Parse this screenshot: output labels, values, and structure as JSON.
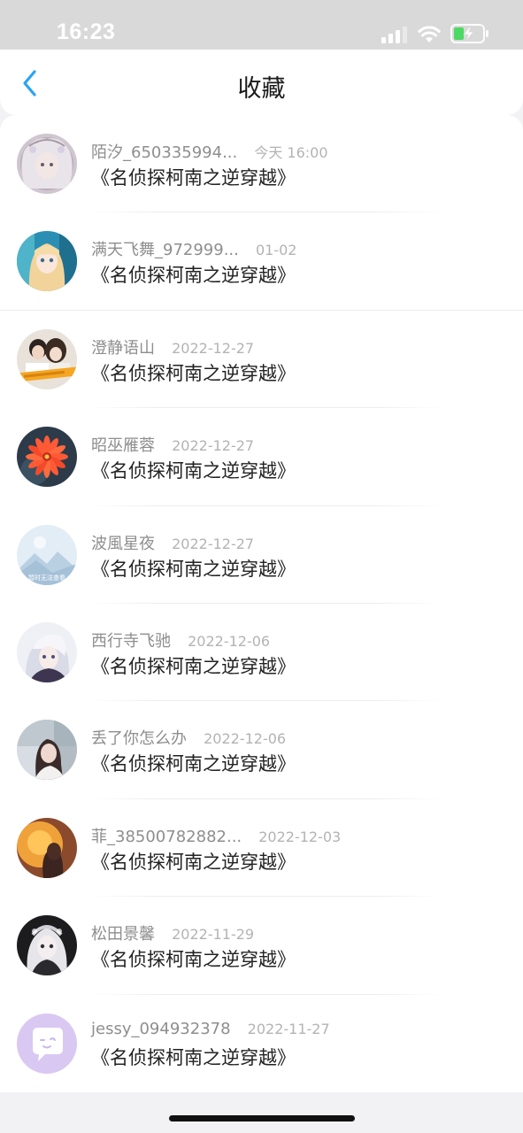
{
  "status_bar": {
    "time": "16:23",
    "icons": [
      "signal-icon",
      "wifi-icon",
      "battery-charging-icon"
    ]
  },
  "nav": {
    "back_icon": "chevron-left-icon",
    "title": "收藏"
  },
  "colors": {
    "accent": "#2aa4f4",
    "battery": "#4cd964"
  },
  "items": [
    {
      "user": "陌汐_650335994...",
      "time": "今天 16:00",
      "title": "《名侦探柯南之逆穿越》",
      "avatar": "anime-girl-avatar"
    },
    {
      "user": "满天飞舞_972999...",
      "time": "01-02",
      "title": "《名侦探柯南之逆穿越》",
      "avatar": "anime-girl-blue-avatar"
    },
    {
      "user": "澄静语山",
      "time": "2022-12-27",
      "title": "《名侦探柯南之逆穿越》",
      "avatar": "couple-photo-avatar"
    },
    {
      "user": "昭巫雁蓉",
      "time": "2022-12-27",
      "title": "《名侦探柯南之逆穿越》",
      "avatar": "red-flower-avatar"
    },
    {
      "user": "波風星夜",
      "time": "2022-12-27",
      "title": "《名侦探柯南之逆穿越》",
      "avatar": "default-landscape-avatar",
      "avatar_text": "暂时无法查看"
    },
    {
      "user": "西行寺飞驰",
      "time": "2022-12-06",
      "title": "《名侦探柯南之逆穿越》",
      "avatar": "anime-character-avatar"
    },
    {
      "user": "丢了你怎么办",
      "time": "2022-12-06",
      "title": "《名侦探柯南之逆穿越》",
      "avatar": "girl-photo-avatar"
    },
    {
      "user": "菲_38500782882...",
      "time": "2022-12-03",
      "title": "《名侦探柯南之逆穿越》",
      "avatar": "silhouette-avatar"
    },
    {
      "user": "松田景馨",
      "time": "2022-11-29",
      "title": "《名侦探柯南之逆穿越》",
      "avatar": "dark-doll-avatar"
    },
    {
      "user": "jessy_094932378",
      "time": "2022-11-27",
      "title": "《名侦探柯南之逆穿越》",
      "avatar": "chat-bubble-avatar"
    }
  ]
}
